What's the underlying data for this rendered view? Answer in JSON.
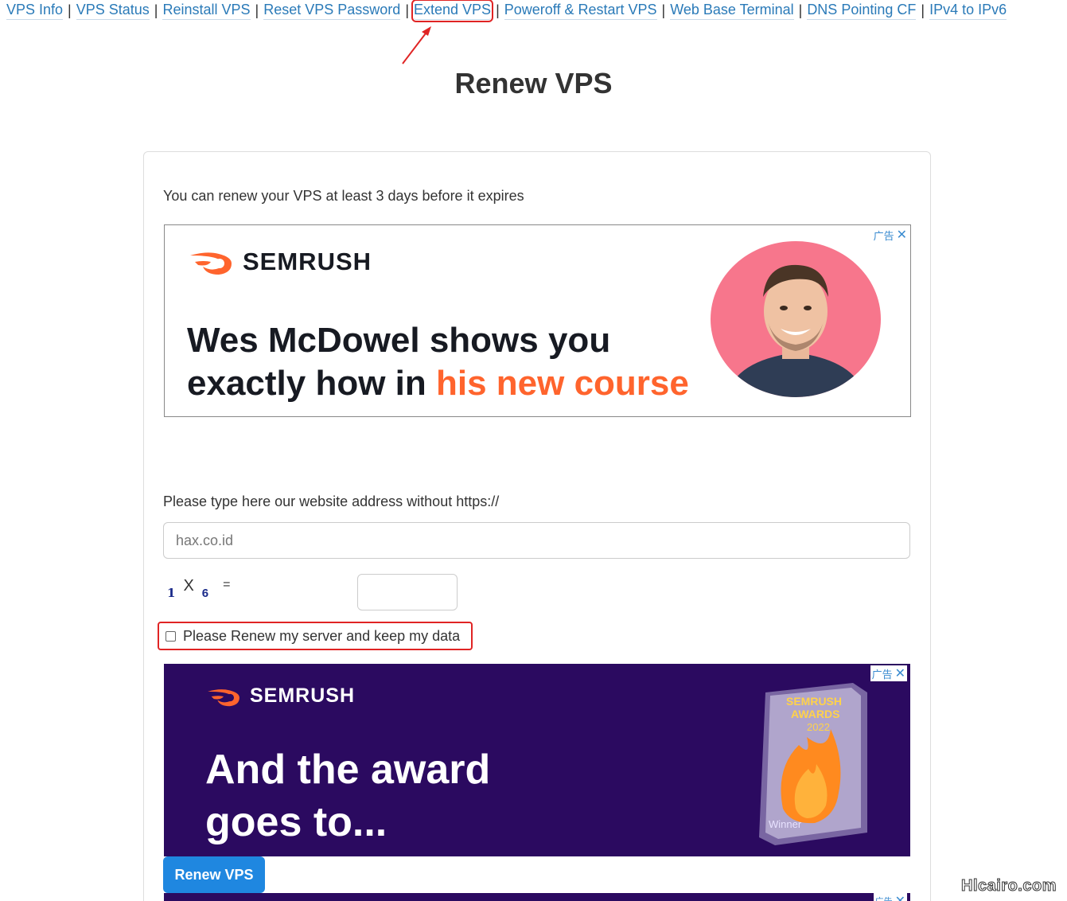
{
  "nav": {
    "items": [
      {
        "label": "VPS Info"
      },
      {
        "label": "VPS Status"
      },
      {
        "label": "Reinstall VPS"
      },
      {
        "label": "Reset VPS Password"
      },
      {
        "label": "Extend VPS",
        "highlighted": true
      },
      {
        "label": "Poweroff & Restart VPS"
      },
      {
        "label": "Web Base Terminal"
      },
      {
        "label": "DNS Pointing CF"
      },
      {
        "label": "IPv4 to IPv6"
      }
    ],
    "separator": "|"
  },
  "page": {
    "title": "Renew VPS",
    "intro": "You can renew your VPS at least 3 days before it expires"
  },
  "ad1": {
    "badge": "广告",
    "close": "✕",
    "brand": "SEMRUSH",
    "headline_line1": "Wes McDowel shows you",
    "headline_line2_prefix": "exactly how in ",
    "headline_line2_accent": "his new course"
  },
  "form": {
    "site_label": "Please type here our website address without https://",
    "site_placeholder": "hax.co.id",
    "captcha_num1": "1",
    "captcha_op": "X",
    "captcha_num2": "6",
    "captcha_eq": "=",
    "checkbox_label": "Please Renew my server and keep my data",
    "checkbox_checked": false,
    "submit_label": "Renew VPS"
  },
  "ad2": {
    "badge": "广告",
    "close": "✕",
    "brand": "SEMRUSH",
    "headline_line1": "And the award",
    "headline_line2": "goes to...",
    "trophy_line1": "SEMRUSH",
    "trophy_line2": "AWARDS",
    "trophy_year": "2022",
    "trophy_footer": "Winner"
  },
  "ad3": {
    "badge": "广告",
    "close": "✕"
  },
  "watermark": "Hlcairo.com",
  "colors": {
    "link": "#2a7ab8",
    "highlight": "#e02424",
    "button": "#1f87e0",
    "semrush_orange": "#ff642d",
    "ad_purple": "#2b0a60",
    "portrait_bg": "#f7768c"
  }
}
